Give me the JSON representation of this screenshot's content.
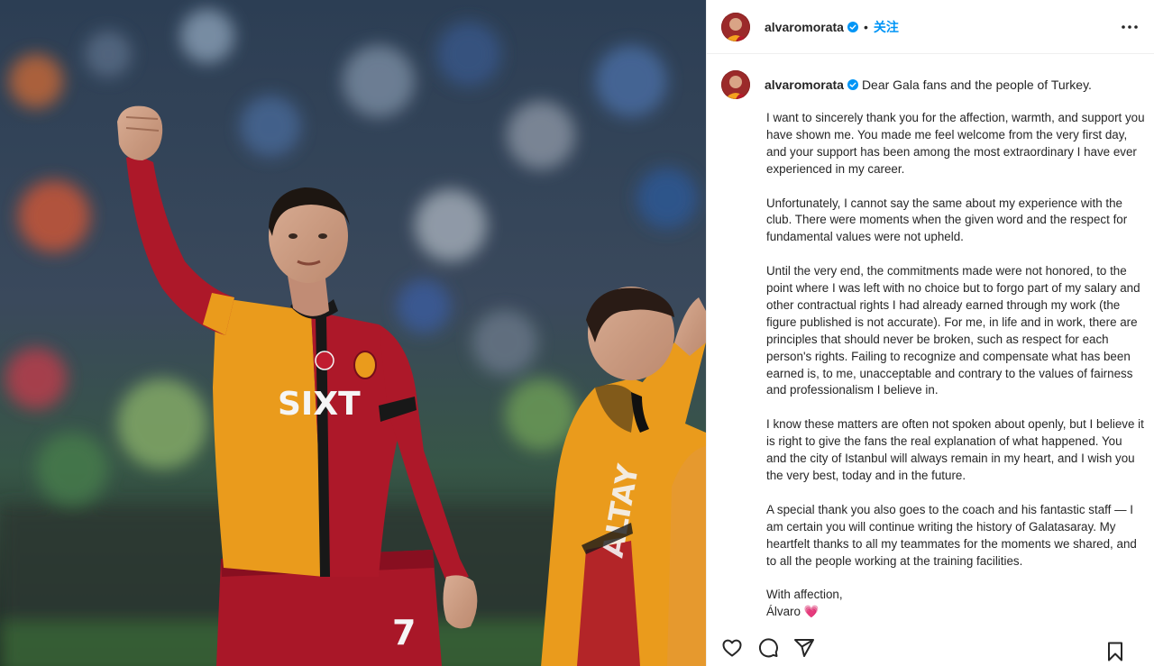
{
  "post": {
    "author": {
      "username": "alvaromorata",
      "verified_icon": "verified-badge-icon",
      "follow_label": "关注",
      "separator": "•"
    },
    "more_icon": "more-options-icon",
    "caption": {
      "first_line": "Dear Gala fans and the people of Turkey.",
      "paragraphs": [
        "I want to sincerely thank you for the affection, warmth, and support you have shown me. You made me feel welcome from the very first day, and your support has been among the most extraordinary I have ever experienced in my career.",
        "Unfortunately, I cannot say the same about my experience with the club. There were moments when the given word and the respect for fundamental values were not upheld.",
        "Until the very end, the commitments made were not honored, to the point where I was left with no choice but to forgo part of my salary and other contractual rights I had already earned through my work (the figure published is not accurate). For me, in life and in work, there are principles that should never be broken, such as respect for each person's rights. Failing to recognize and compensate what has been earned is, to me, unacceptable and contrary to the values of fairness and professionalism I believe in.",
        "I know these matters are often not spoken about openly, but I believe it is right to give the fans the real explanation of what happened. You and the city of Istanbul will always remain in my heart, and I wish you the very best, today and in the future.",
        "A special thank you also goes to the coach and his fantastic staff — I am certain you will continue writing the history of Galatasaray. My heartfelt thanks to all my teammates for the moments we shared, and to all the people working at the training facilities."
      ],
      "sign_off": "With affection,",
      "signature": "Álvaro",
      "signature_emoji": "💗"
    },
    "photo": {
      "jersey_sponsor": "SIXT",
      "jersey_number": "7",
      "teammate_sponsor": "ALTAY",
      "colors": {
        "yellow": "#f4a21e",
        "red": "#b5192b",
        "crowd": "#22344a"
      }
    },
    "actions": {
      "like_icon": "heart-icon",
      "comment_icon": "comment-icon",
      "share_icon": "share-icon",
      "save_icon": "bookmark-icon"
    }
  }
}
